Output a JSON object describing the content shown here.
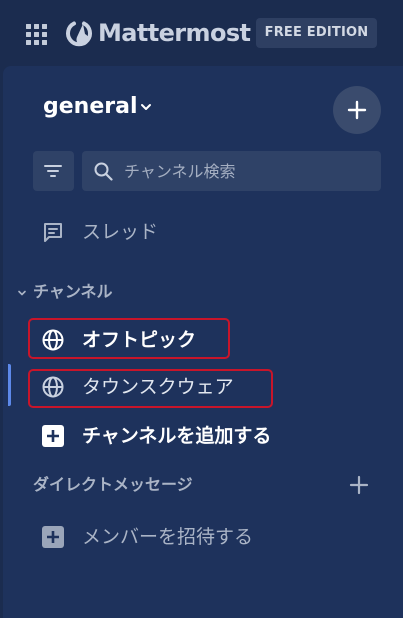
{
  "header": {
    "brand_icons": [
      "grid-icon",
      "mattermost-logo-icon"
    ],
    "brand_name": "Mattermost",
    "edition_label": "FREE EDITION"
  },
  "sidebar": {
    "team_name": "general",
    "search": {
      "placeholder": "チャンネル検索",
      "value": ""
    },
    "threads": {
      "label": "スレッド",
      "icon": "message-text-icon"
    },
    "channels_section": {
      "title": "チャンネル",
      "items": [
        {
          "label": "オフトピック",
          "icon": "globe-icon",
          "unread": true
        },
        {
          "label": "タウンスクウェア",
          "icon": "globe-icon",
          "active": true
        }
      ],
      "add_channel_label": "チャンネルを追加する"
    },
    "direct_messages_section": {
      "title": "ダイレクトメッセージ"
    },
    "invite_members_label": "メンバーを招待する"
  },
  "colors": {
    "background": "#1b2c4f",
    "sidebar": "#1e325c",
    "active_indicator": "#5d89ea",
    "annotation_highlight": "#c8152a"
  }
}
